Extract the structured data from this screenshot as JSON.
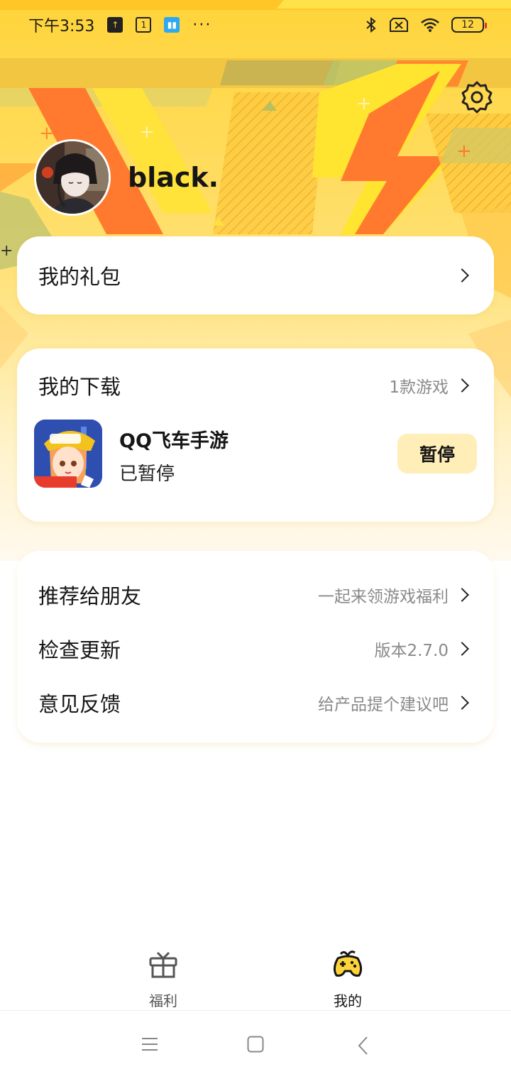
{
  "status_bar": {
    "time": "下午3:53",
    "notif_icons": [
      "upload-icon",
      "calendar-icon",
      "app-icon"
    ],
    "more": "···",
    "battery_level": "12"
  },
  "profile": {
    "username": "black."
  },
  "gift_card": {
    "title": "我的礼包"
  },
  "download_card": {
    "title": "我的下载",
    "count": "1款游戏",
    "game": {
      "name": "QQ飞车手游",
      "status": "已暂停",
      "action": "暂停"
    }
  },
  "menu": [
    {
      "label": "推荐给朋友",
      "sub": "一起来领游戏福利"
    },
    {
      "label": "检查更新",
      "sub": "版本2.7.0"
    },
    {
      "label": "意见反馈",
      "sub": "给产品提个建议吧"
    }
  ],
  "tabs": [
    {
      "label": "福利",
      "icon": "gift-icon"
    },
    {
      "label": "我的",
      "icon": "gamepad-icon"
    }
  ],
  "colors": {
    "brand_yellow": "#ffd43a",
    "accent_orange": "#ff7a2e",
    "button_bg": "#ffeeb8"
  }
}
